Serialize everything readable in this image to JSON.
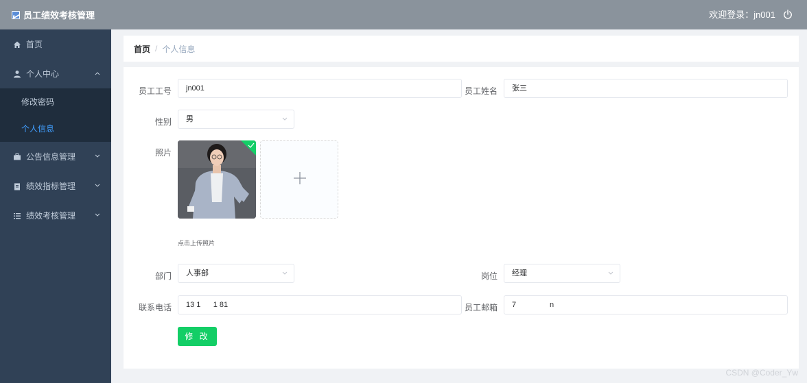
{
  "topbar": {
    "title": "员工绩效考核管理",
    "welcome": "欢迎登录：jn001"
  },
  "sidebar": {
    "items": [
      {
        "label": "首页",
        "icon": "home-icon"
      },
      {
        "label": "个人中心",
        "icon": "user-icon",
        "expanded": true,
        "children": [
          {
            "label": "修改密码",
            "active": false
          },
          {
            "label": "个人信息",
            "active": true
          }
        ]
      },
      {
        "label": "公告信息管理",
        "icon": "briefcase-icon"
      },
      {
        "label": "绩效指标管理",
        "icon": "clipboard-icon"
      },
      {
        "label": "绩效考核管理",
        "icon": "list-icon"
      }
    ]
  },
  "breadcrumb": {
    "home": "首页",
    "separator": "/",
    "current": "个人信息"
  },
  "form": {
    "employee_id": {
      "label": "员工工号",
      "value": "jn001"
    },
    "employee_name": {
      "label": "员工姓名",
      "value": "张三"
    },
    "gender": {
      "label": "性别",
      "value": "男"
    },
    "photo": {
      "label": "照片",
      "hint": "点击上传照片",
      "upload_glyph": "+"
    },
    "department": {
      "label": "部门",
      "value": "人事部"
    },
    "position": {
      "label": "岗位",
      "value": "经理"
    },
    "phone": {
      "label": "联系电话",
      "value": "13 1      1 81"
    },
    "email": {
      "label": "员工邮箱",
      "value": "7                n"
    },
    "submit_label": "修 改"
  },
  "watermark": "CSDN @Coder_Yw",
  "colors": {
    "topbar": "#8a939c",
    "sidebar": "#304156",
    "active": "#409eff",
    "button": "#13ce66"
  }
}
